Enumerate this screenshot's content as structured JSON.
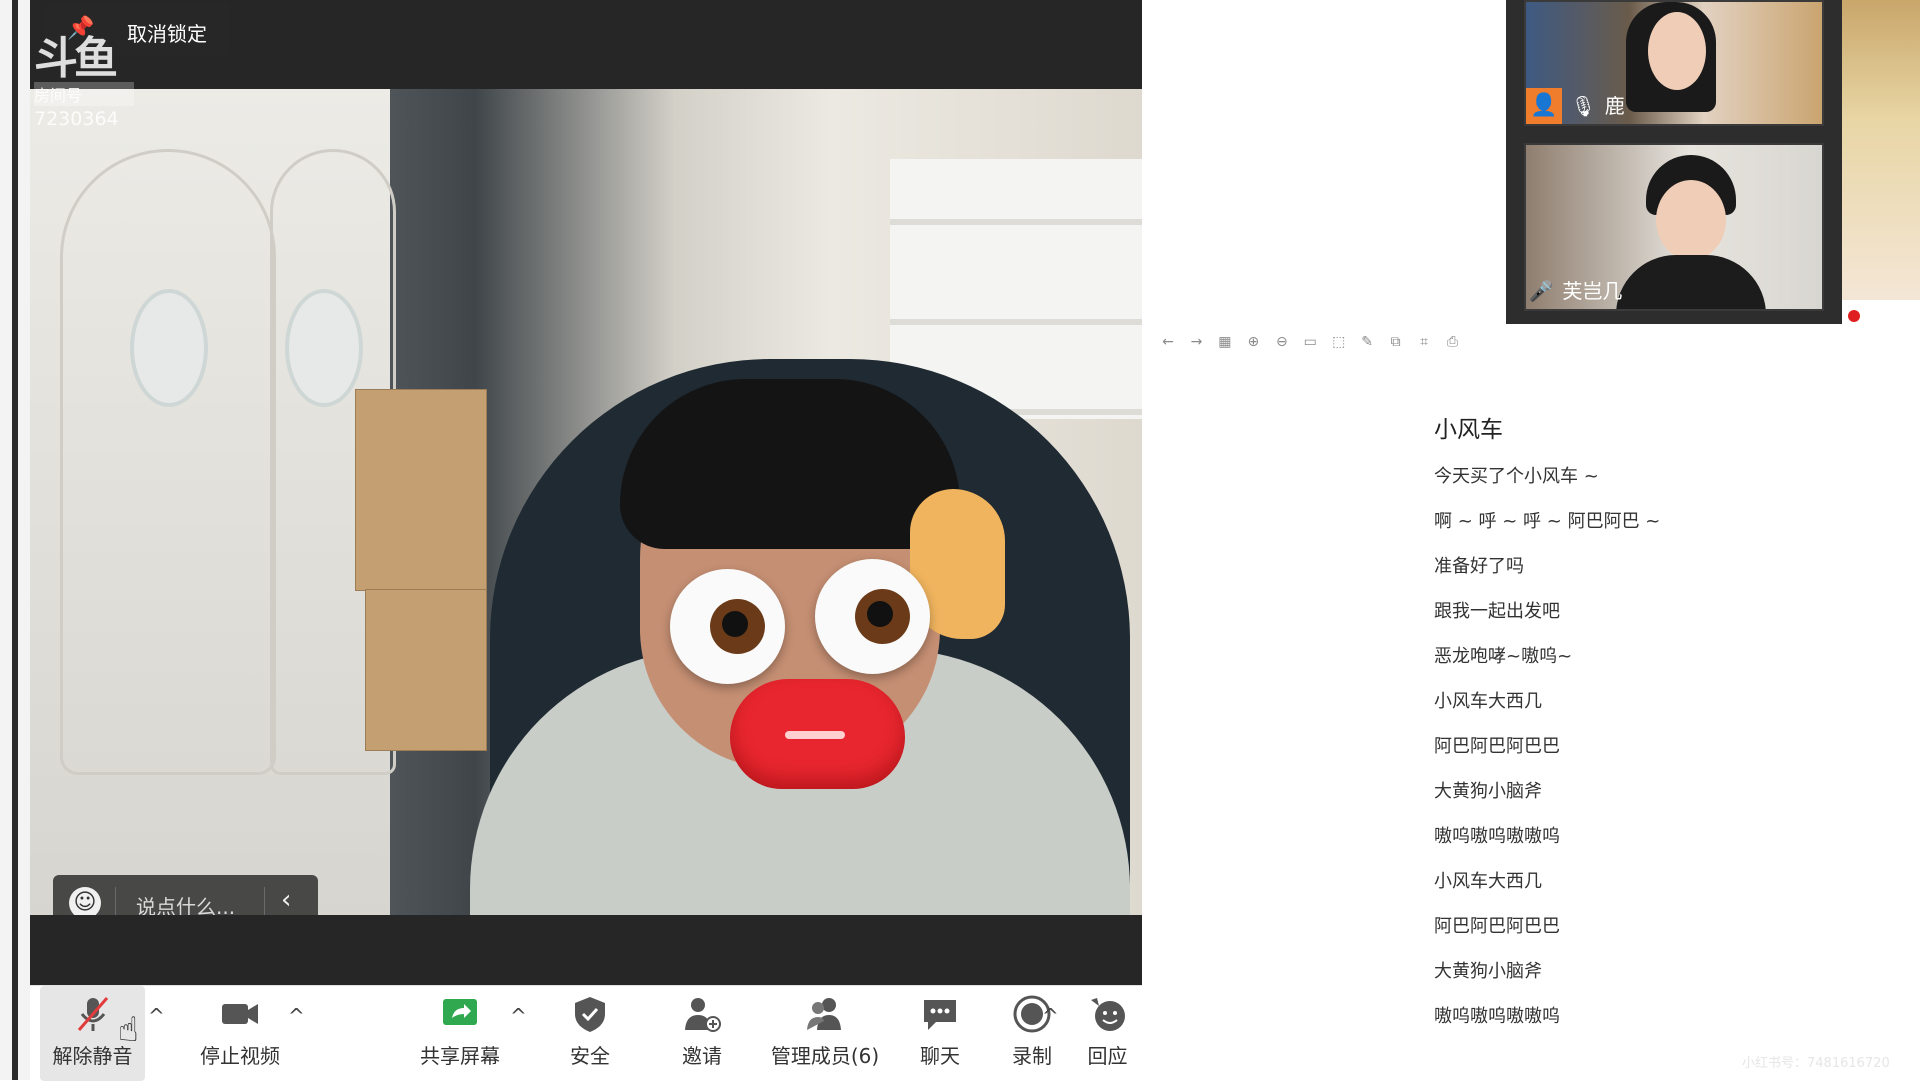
{
  "overlay": {
    "unlock_label": "取消锁定",
    "watermark_logo": "斗鱼",
    "watermark_room_label": "房间号",
    "watermark_room_number": "7230364",
    "chat_placeholder": "说点什么..."
  },
  "toolbar": {
    "buttons": [
      {
        "label": "解除静音",
        "icon": "muted-mic-icon"
      },
      {
        "label": "停止视频",
        "icon": "video-camera-icon"
      },
      {
        "label": "共享屏幕",
        "icon": "share-screen-icon"
      },
      {
        "label": "安全",
        "icon": "shield-icon"
      },
      {
        "label": "邀请",
        "icon": "add-user-icon"
      },
      {
        "label": "管理成员(6)",
        "icon": "members-icon"
      },
      {
        "label": "聊天",
        "icon": "chat-bubble-icon"
      },
      {
        "label": "录制",
        "icon": "record-icon"
      },
      {
        "label": "回应",
        "icon": "reaction-icon"
      }
    ]
  },
  "participants": [
    {
      "name": "鹿",
      "muted": true
    },
    {
      "name": "芙岂几",
      "muted": false
    }
  ],
  "document": {
    "title": "小风车",
    "lines": [
      "今天买了个小风车 ~",
      "啊 ~ 呼 ~ 呼 ~ 阿巴阿巴 ~",
      "准备好了吗",
      "跟我一起出发吧",
      "恶龙咆哮~嗷呜~",
      "小风车大西几",
      "阿巴阿巴阿巴巴",
      "大黄狗小脑斧",
      "嗷呜嗷呜嗷嗷呜",
      "小风车大西几",
      "阿巴阿巴阿巴巴",
      "大黄狗小脑斧",
      "嗷呜嗷呜嗷嗷呜"
    ],
    "footer_watermark": "小红书号：7481616720"
  },
  "colors": {
    "accent_green": "#2fa84f",
    "mute_red": "#e23b3b",
    "avatar_orange": "#f07d2c"
  }
}
